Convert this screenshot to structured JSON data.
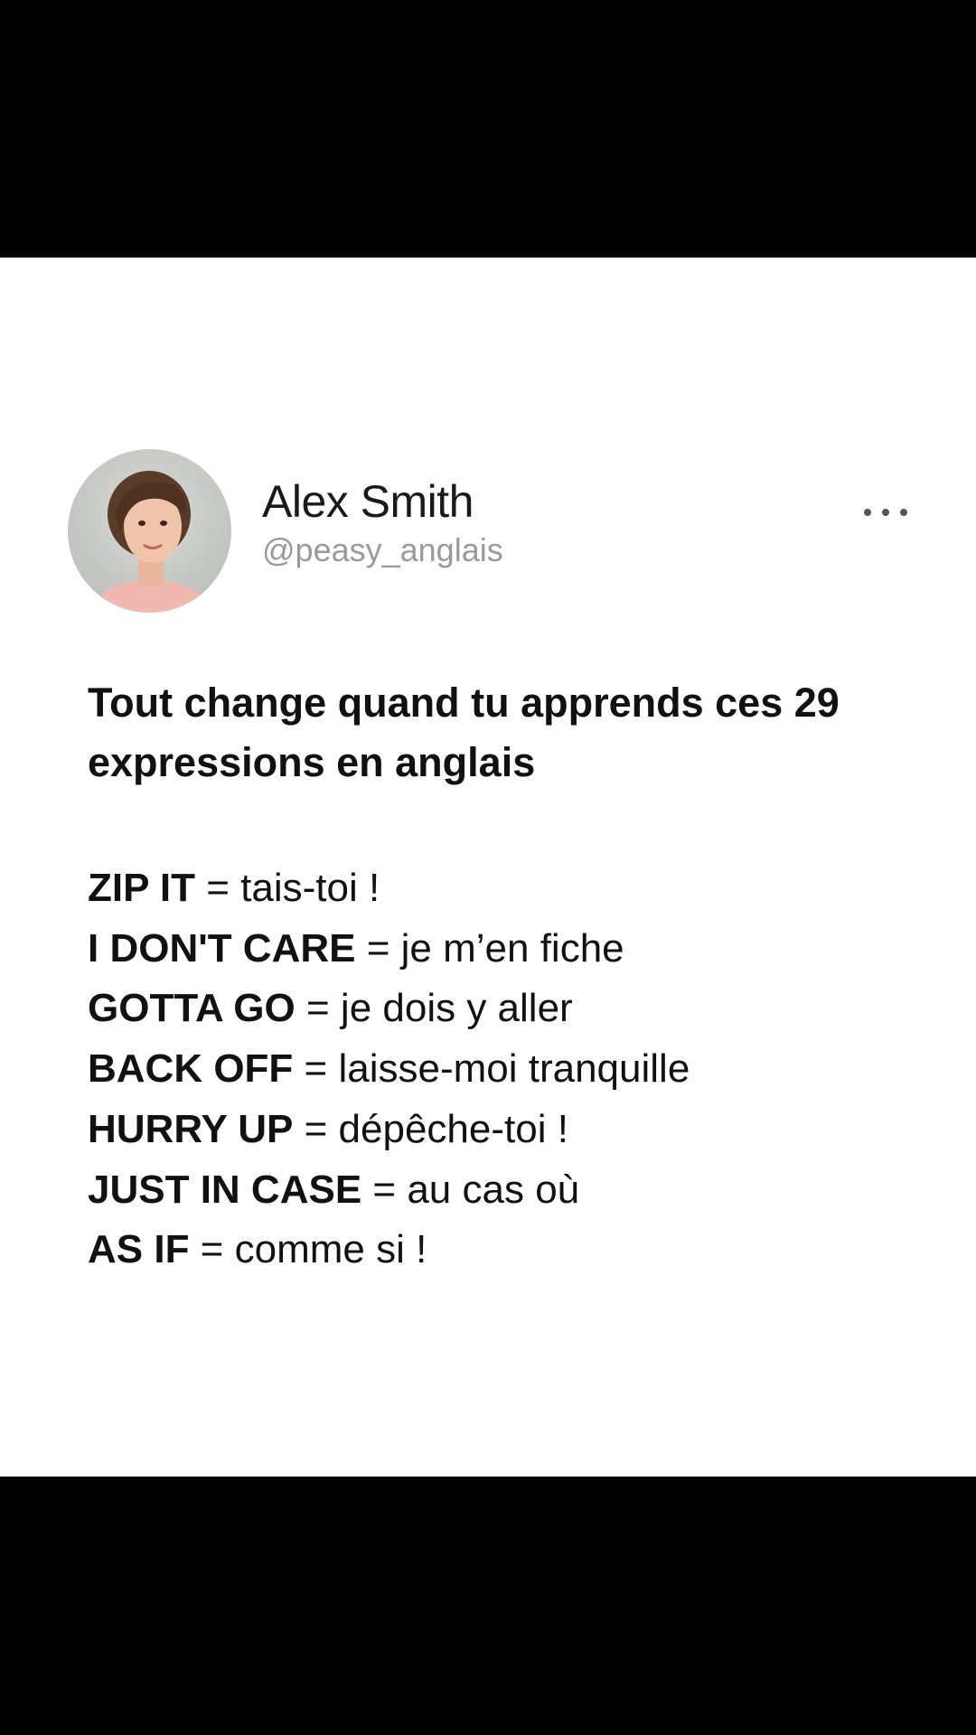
{
  "post": {
    "author_name": "Alex Smith",
    "author_handle": "@peasy_anglais",
    "avatar_icon": "profile-photo",
    "more_icon": "ellipsis-horizontal",
    "headline": "Tout change quand tu apprends ces 29 expressions en anglais",
    "expressions": [
      {
        "term": "ZIP IT",
        "sep": " = ",
        "meaning": "tais-toi !"
      },
      {
        "term": "I DON'T CARE",
        "sep": " = ",
        "meaning": "je m’en fiche"
      },
      {
        "term": "GOTTA GO",
        "sep": " = ",
        "meaning": "je dois y aller"
      },
      {
        "term": "BACK OFF",
        "sep": " = ",
        "meaning": "laisse-moi tranquille"
      },
      {
        "term": "HURRY UP",
        "sep": " = ",
        "meaning": "dépêche-toi !"
      },
      {
        "term": "JUST IN CASE",
        "sep": " = ",
        "meaning": "au cas où"
      },
      {
        "term": "AS IF",
        "sep": " = ",
        "meaning": "comme si !"
      }
    ]
  },
  "colors": {
    "letterbox": "#000000",
    "card": "#ffffff",
    "text": "#111111",
    "handle": "#9a9a9a"
  }
}
